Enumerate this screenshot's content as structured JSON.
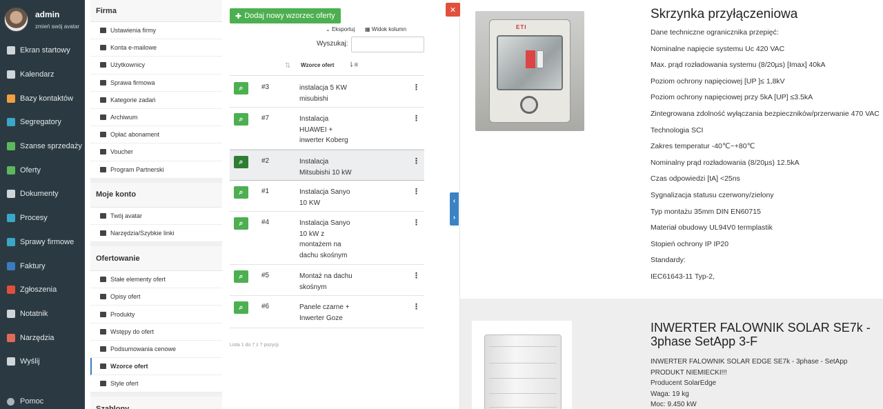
{
  "user": {
    "name": "admin",
    "change_avatar": "zmień swój avatar"
  },
  "nav": {
    "items": [
      {
        "label": "Ekran startowy",
        "icon": "monitor-icon",
        "color": "#cfd6d9"
      },
      {
        "label": "Kalendarz",
        "icon": "calendar-icon",
        "color": "#cfd6d9"
      },
      {
        "label": "Bazy kontaktów",
        "icon": "contacts-icon",
        "color": "#f0a040"
      },
      {
        "label": "Segregatory",
        "icon": "folder-icon",
        "color": "#3aa7c8"
      },
      {
        "label": "Szanse sprzedaży",
        "icon": "refresh-icon",
        "color": "#5cb85c"
      },
      {
        "label": "Oferty",
        "icon": "document-icon",
        "color": "#5cb85c"
      },
      {
        "label": "Dokumenty",
        "icon": "file-icon",
        "color": "#cfd6d9"
      },
      {
        "label": "Procesy",
        "icon": "sync-icon",
        "color": "#3aa7c8"
      },
      {
        "label": "Sprawy firmowe",
        "icon": "briefcase-icon",
        "color": "#3aa7c8"
      },
      {
        "label": "Faktury",
        "icon": "invoice-icon",
        "color": "#3b7bbf"
      },
      {
        "label": "Zgłoszenia",
        "icon": "ticket-icon",
        "color": "#e0503a"
      },
      {
        "label": "Notatnik",
        "icon": "notebook-icon",
        "color": "#cfd6d9"
      },
      {
        "label": "Narzędzia",
        "icon": "tools-icon",
        "color": "#e06a5a"
      },
      {
        "label": "Wyślij",
        "icon": "send-icon",
        "color": "#cfd6d9"
      }
    ],
    "help": "Pomoc"
  },
  "settings": {
    "firma": {
      "title": "Firma",
      "items": [
        "Ustawienia firmy",
        "Konta e-mailowe",
        "Użytkownicy",
        "Sprawa firmowa",
        "Kategorie zadań",
        "Archiwum",
        "Opłać abonament",
        "Voucher",
        "Program Partnerski"
      ]
    },
    "konto": {
      "title": "Moje konto",
      "items": [
        "Twój avatar",
        "Narzędzia/Szybkie linki"
      ]
    },
    "oferty": {
      "title": "Ofertowanie",
      "items": [
        "Stałe elementy ofert",
        "Opisy ofert",
        "Produkty",
        "Wstępy do ofert",
        "Podsumowania cenowe",
        "Wzorce ofert",
        "Style ofert"
      ]
    },
    "szablony": {
      "title": "Szablony"
    }
  },
  "list": {
    "add_label": "Dodaj nowy wzorzec oferty",
    "export_label": "Eksportuj",
    "columns_label": "Widok kolumn",
    "search_label": "Wyszukaj:",
    "search_value": "",
    "column_header": "Wzorce ofert",
    "rows": [
      {
        "id": "#3",
        "name": "instalacja 5 KW misubishi"
      },
      {
        "id": "#7",
        "name": "Instalacja HUAWEI + inwerter Koberg"
      },
      {
        "id": "#2",
        "name": "Instalacja Mitsubishi 10 kW"
      },
      {
        "id": "#1",
        "name": "Instalacja Sanyo 10 KW"
      },
      {
        "id": "#4",
        "name": "Instalacja Sanyo 10 kW z montażem na dachu skośnym"
      },
      {
        "id": "#5",
        "name": "Montaż na dachu skośnym"
      },
      {
        "id": "#6",
        "name": "Panele czarne + Inwerter Goze"
      }
    ],
    "info": "Lista 1 do 7 z 7 pozycji"
  },
  "preview": {
    "product1": {
      "title": "Skrzynka przyłączeniowa",
      "specs": [
        "Dane techniczne ogranicznika przepięć:",
        "Nominalne napięcie systemu Uc 420 VAC",
        "Max. prąd rozładowania systemu (8/20µs) [Imax]   40kA",
        "Poziom ochrony napięciowej [UP   ]≤ 1,8kV",
        "Poziom ochrony napięciowej przy 5kA [UP]   ≤3.5kA",
        "Zintegrowana zdolność wyłączania bezpieczników/przerwanie 470 VAC",
        "Technologia   SCI",
        "Zakres temperatur   -40℃~+80℃",
        "Nominalny prąd rozładowania (8/20µs)   12.5kA",
        "Czas odpowiedzi [tA]   <25ns",
        "Sygnalizacja statusu   czerwony/zielony",
        "Typ montażu   35mm DIN EN60715",
        "Materiał obudowy   UL94V0 termplastik",
        "Stopień ochrony IP   IP20",
        "Standardy:",
        "IEC61643-11 Typ-2,"
      ],
      "img_logo": "ETI"
    },
    "product2": {
      "title": "INWERTER FALOWNIK SOLAR SE7k - 3phase SetApp 3-F",
      "specs": [
        "INWERTER FALOWNIK SOLAR EDGE SE7k - 3phase - SetApp",
        "PRODUKT NIEMIECKI!!!",
        "Producent SolarEdge",
        "Waga: 19 kg",
        "Moc: 9.450 kW"
      ]
    }
  }
}
